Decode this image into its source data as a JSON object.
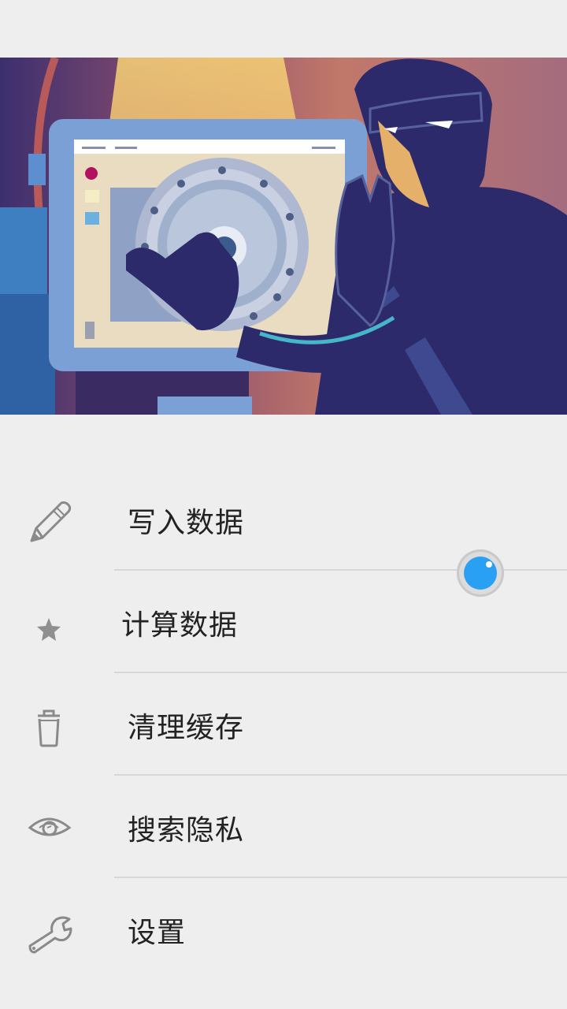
{
  "hero": {
    "image": "hacker-cracking-safe-illustration"
  },
  "menu": {
    "items": [
      {
        "label": "写入数据",
        "icon": "pencil-icon"
      },
      {
        "label": "计算数据",
        "icon": "star-icon"
      },
      {
        "label": "清理缓存",
        "icon": "trash-icon"
      },
      {
        "label": "搜索隐私",
        "icon": "eye-icon"
      },
      {
        "label": "设置",
        "icon": "wrench-icon"
      }
    ]
  },
  "floating_button": {
    "icon": "assistive-touch-icon",
    "color": "#2aa0f4"
  }
}
